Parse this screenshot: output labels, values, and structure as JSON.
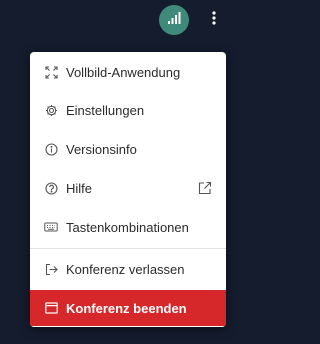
{
  "colors": {
    "background": "#141c2e",
    "signal_button": "#3f8a7b",
    "danger": "#d6282b"
  },
  "header": {
    "signal_icon": "signal-bars-icon",
    "more_icon": "more-vertical-icon"
  },
  "menu": {
    "items": [
      {
        "label": "Vollbild-Anwendung",
        "icon": "fullscreen-icon"
      },
      {
        "label": "Einstellungen",
        "icon": "gear-icon"
      },
      {
        "label": "Versionsinfo",
        "icon": "info-icon"
      },
      {
        "label": "Hilfe",
        "icon": "help-icon",
        "trailing_icon": "external-link-icon"
      },
      {
        "label": "Tastenkombinationen",
        "icon": "keyboard-icon"
      },
      {
        "label": "Konferenz verlassen",
        "icon": "leave-icon"
      },
      {
        "label": "Konferenz beenden",
        "icon": "window-icon"
      }
    ]
  }
}
